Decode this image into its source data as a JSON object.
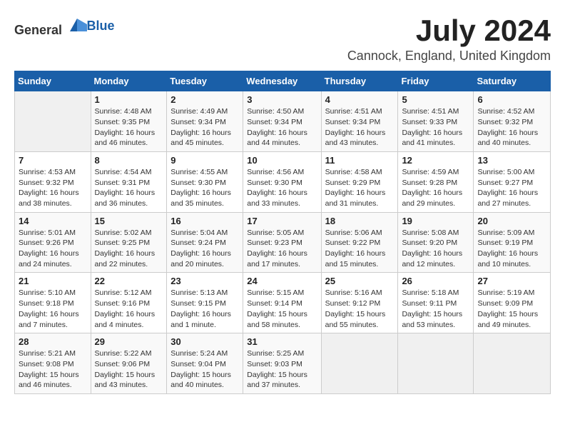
{
  "header": {
    "logo_general": "General",
    "logo_blue": "Blue",
    "title": "July 2024",
    "subtitle": "Cannock, England, United Kingdom"
  },
  "days_of_week": [
    "Sunday",
    "Monday",
    "Tuesday",
    "Wednesday",
    "Thursday",
    "Friday",
    "Saturday"
  ],
  "weeks": [
    [
      {
        "day": "",
        "info": ""
      },
      {
        "day": "1",
        "info": "Sunrise: 4:48 AM\nSunset: 9:35 PM\nDaylight: 16 hours\nand 46 minutes."
      },
      {
        "day": "2",
        "info": "Sunrise: 4:49 AM\nSunset: 9:34 PM\nDaylight: 16 hours\nand 45 minutes."
      },
      {
        "day": "3",
        "info": "Sunrise: 4:50 AM\nSunset: 9:34 PM\nDaylight: 16 hours\nand 44 minutes."
      },
      {
        "day": "4",
        "info": "Sunrise: 4:51 AM\nSunset: 9:34 PM\nDaylight: 16 hours\nand 43 minutes."
      },
      {
        "day": "5",
        "info": "Sunrise: 4:51 AM\nSunset: 9:33 PM\nDaylight: 16 hours\nand 41 minutes."
      },
      {
        "day": "6",
        "info": "Sunrise: 4:52 AM\nSunset: 9:32 PM\nDaylight: 16 hours\nand 40 minutes."
      }
    ],
    [
      {
        "day": "7",
        "info": "Sunrise: 4:53 AM\nSunset: 9:32 PM\nDaylight: 16 hours\nand 38 minutes."
      },
      {
        "day": "8",
        "info": "Sunrise: 4:54 AM\nSunset: 9:31 PM\nDaylight: 16 hours\nand 36 minutes."
      },
      {
        "day": "9",
        "info": "Sunrise: 4:55 AM\nSunset: 9:30 PM\nDaylight: 16 hours\nand 35 minutes."
      },
      {
        "day": "10",
        "info": "Sunrise: 4:56 AM\nSunset: 9:30 PM\nDaylight: 16 hours\nand 33 minutes."
      },
      {
        "day": "11",
        "info": "Sunrise: 4:58 AM\nSunset: 9:29 PM\nDaylight: 16 hours\nand 31 minutes."
      },
      {
        "day": "12",
        "info": "Sunrise: 4:59 AM\nSunset: 9:28 PM\nDaylight: 16 hours\nand 29 minutes."
      },
      {
        "day": "13",
        "info": "Sunrise: 5:00 AM\nSunset: 9:27 PM\nDaylight: 16 hours\nand 27 minutes."
      }
    ],
    [
      {
        "day": "14",
        "info": "Sunrise: 5:01 AM\nSunset: 9:26 PM\nDaylight: 16 hours\nand 24 minutes."
      },
      {
        "day": "15",
        "info": "Sunrise: 5:02 AM\nSunset: 9:25 PM\nDaylight: 16 hours\nand 22 minutes."
      },
      {
        "day": "16",
        "info": "Sunrise: 5:04 AM\nSunset: 9:24 PM\nDaylight: 16 hours\nand 20 minutes."
      },
      {
        "day": "17",
        "info": "Sunrise: 5:05 AM\nSunset: 9:23 PM\nDaylight: 16 hours\nand 17 minutes."
      },
      {
        "day": "18",
        "info": "Sunrise: 5:06 AM\nSunset: 9:22 PM\nDaylight: 16 hours\nand 15 minutes."
      },
      {
        "day": "19",
        "info": "Sunrise: 5:08 AM\nSunset: 9:20 PM\nDaylight: 16 hours\nand 12 minutes."
      },
      {
        "day": "20",
        "info": "Sunrise: 5:09 AM\nSunset: 9:19 PM\nDaylight: 16 hours\nand 10 minutes."
      }
    ],
    [
      {
        "day": "21",
        "info": "Sunrise: 5:10 AM\nSunset: 9:18 PM\nDaylight: 16 hours\nand 7 minutes."
      },
      {
        "day": "22",
        "info": "Sunrise: 5:12 AM\nSunset: 9:16 PM\nDaylight: 16 hours\nand 4 minutes."
      },
      {
        "day": "23",
        "info": "Sunrise: 5:13 AM\nSunset: 9:15 PM\nDaylight: 16 hours\nand 1 minute."
      },
      {
        "day": "24",
        "info": "Sunrise: 5:15 AM\nSunset: 9:14 PM\nDaylight: 15 hours\nand 58 minutes."
      },
      {
        "day": "25",
        "info": "Sunrise: 5:16 AM\nSunset: 9:12 PM\nDaylight: 15 hours\nand 55 minutes."
      },
      {
        "day": "26",
        "info": "Sunrise: 5:18 AM\nSunset: 9:11 PM\nDaylight: 15 hours\nand 53 minutes."
      },
      {
        "day": "27",
        "info": "Sunrise: 5:19 AM\nSunset: 9:09 PM\nDaylight: 15 hours\nand 49 minutes."
      }
    ],
    [
      {
        "day": "28",
        "info": "Sunrise: 5:21 AM\nSunset: 9:08 PM\nDaylight: 15 hours\nand 46 minutes."
      },
      {
        "day": "29",
        "info": "Sunrise: 5:22 AM\nSunset: 9:06 PM\nDaylight: 15 hours\nand 43 minutes."
      },
      {
        "day": "30",
        "info": "Sunrise: 5:24 AM\nSunset: 9:04 PM\nDaylight: 15 hours\nand 40 minutes."
      },
      {
        "day": "31",
        "info": "Sunrise: 5:25 AM\nSunset: 9:03 PM\nDaylight: 15 hours\nand 37 minutes."
      },
      {
        "day": "",
        "info": ""
      },
      {
        "day": "",
        "info": ""
      },
      {
        "day": "",
        "info": ""
      }
    ]
  ]
}
